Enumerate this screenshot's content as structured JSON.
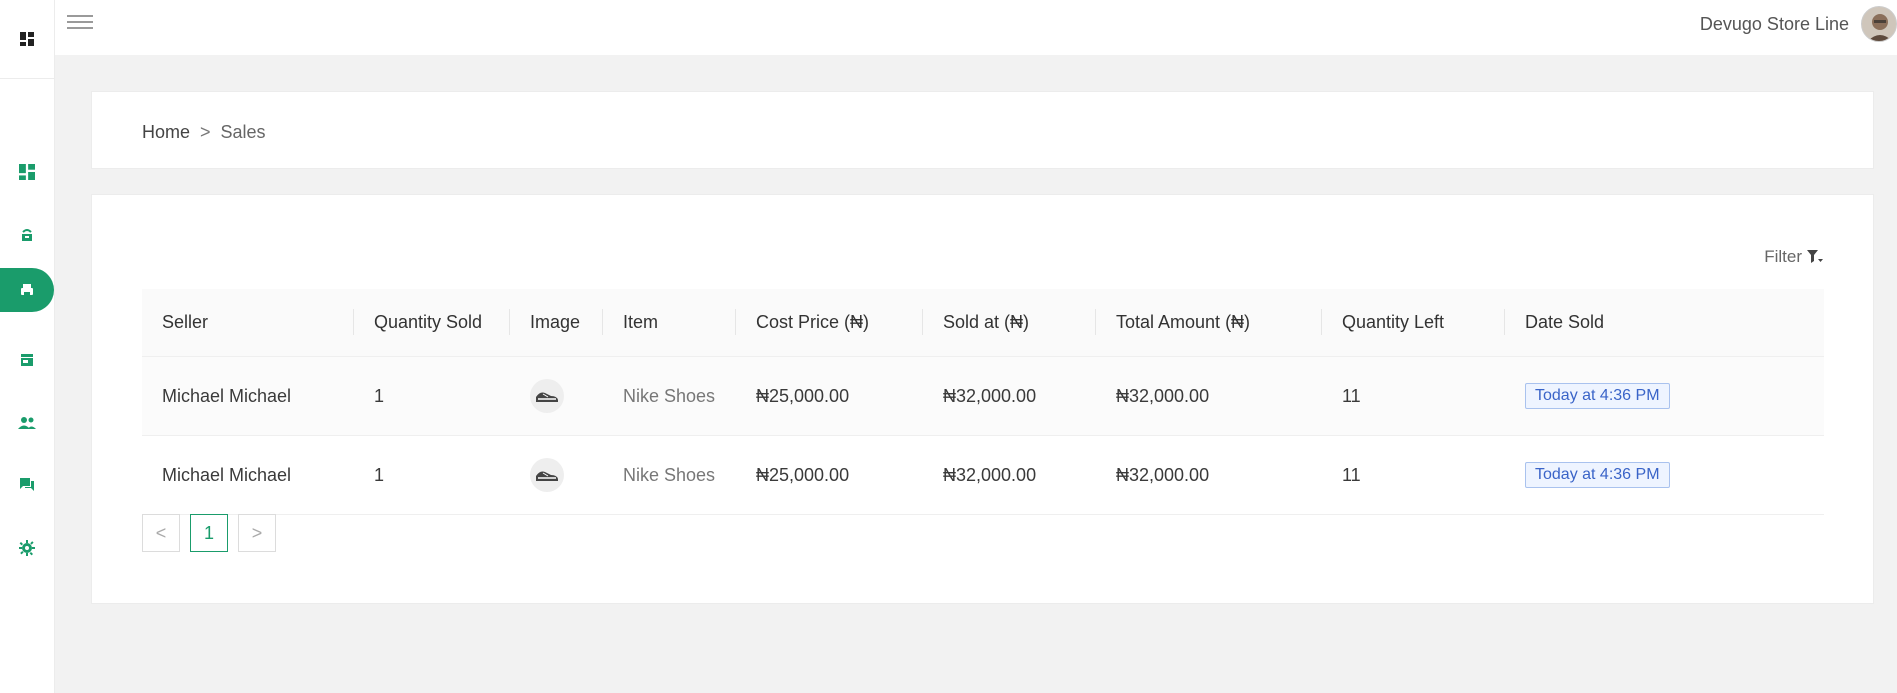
{
  "theme": {
    "accent": "#1a9c6b",
    "date_tag": "#3a64c8"
  },
  "sidebar": {
    "items": [
      {
        "icon": "dashboard-icon"
      },
      {
        "icon": "phone-icon"
      },
      {
        "icon": "sales-icon",
        "active": true
      },
      {
        "icon": "store-icon"
      },
      {
        "icon": "users-icon"
      },
      {
        "icon": "chat-icon"
      },
      {
        "icon": "settings-icon"
      }
    ]
  },
  "header": {
    "store_name": "Devugo Store Line"
  },
  "breadcrumb": {
    "home": "Home",
    "separator": ">",
    "current": "Sales"
  },
  "filter": {
    "label": "Filter"
  },
  "table": {
    "columns": [
      "Seller",
      "Quantity Sold",
      "Image",
      "Item",
      "Cost Price (₦)",
      "Sold at (₦)",
      "Total Amount (₦)",
      "Quantity Left",
      "Date Sold"
    ],
    "rows": [
      {
        "seller": "Michael Michael",
        "quantity_sold": "1",
        "item": "Nike Shoes",
        "cost_price": "₦25,000.00",
        "sold_at": "₦32,000.00",
        "total_amount": "₦32,000.00",
        "quantity_left": "11",
        "date_sold": "Today at 4:36 PM"
      },
      {
        "seller": "Michael Michael",
        "quantity_sold": "1",
        "item": "Nike Shoes",
        "cost_price": "₦25,000.00",
        "sold_at": "₦32,000.00",
        "total_amount": "₦32,000.00",
        "quantity_left": "11",
        "date_sold": "Today at 4:36 PM"
      }
    ]
  },
  "pagination": {
    "prev": "<",
    "current": "1",
    "next": ">"
  }
}
